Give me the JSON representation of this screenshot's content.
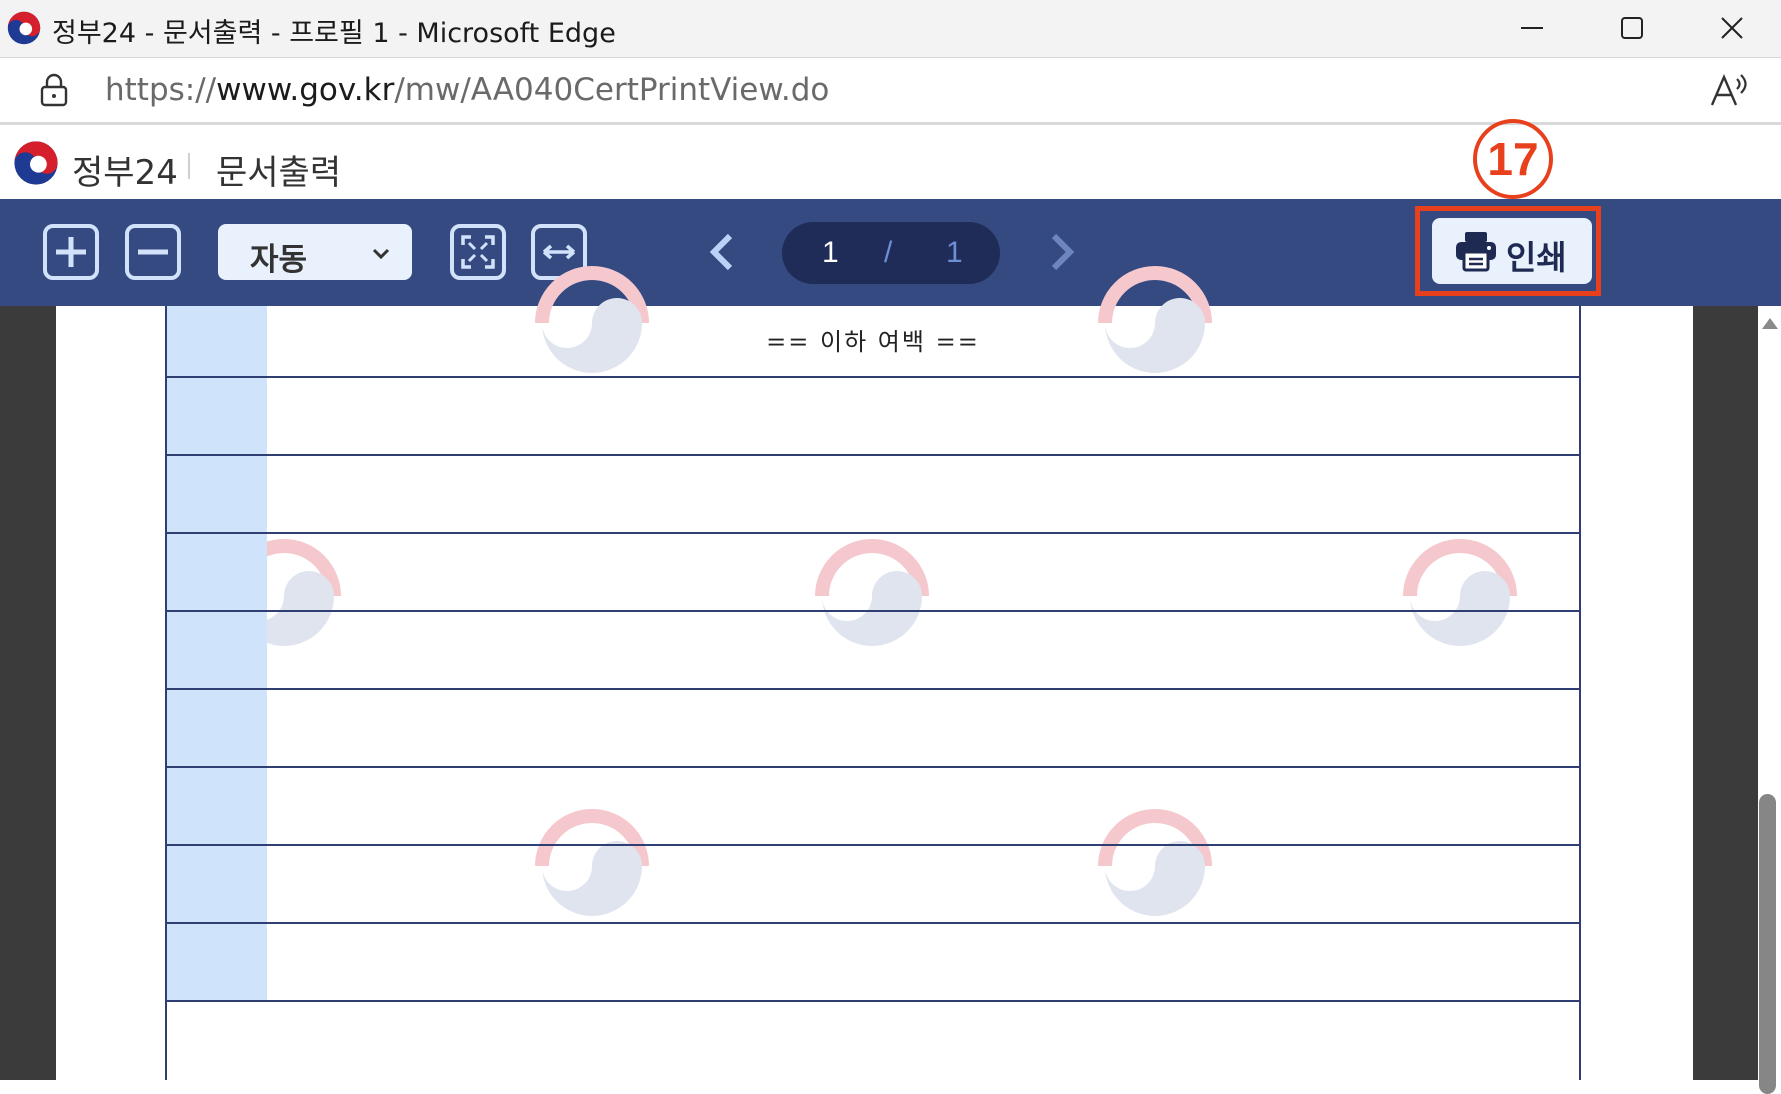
{
  "window": {
    "title": "정부24 - 문서출력 - 프로필 1 - Microsoft Edge",
    "controls": [
      "minimize",
      "maximize",
      "close"
    ]
  },
  "address_bar": {
    "url_prefix": "https://",
    "url_host": "www.gov.kr",
    "url_path": "/mw/AA040CertPrintView.do"
  },
  "site_header": {
    "site_name": "정부24",
    "page_name": "문서출력"
  },
  "step_badge": "17",
  "toolbar": {
    "zoom_value": "자동",
    "current_page": "1",
    "separator": "/",
    "total_pages": "1",
    "print_label": "인쇄",
    "icons": [
      "zoom-in-icon",
      "zoom-out-icon",
      "fit-page-icon",
      "fit-width-icon",
      "chevron-left-icon",
      "chevron-right-icon",
      "printer-icon"
    ]
  },
  "document": {
    "note": "== 이하 여백 =="
  },
  "colors": {
    "toolbar_bg": "#354a80",
    "highlight": "#e8401c",
    "page_pill": "#1e2c57",
    "button_bg": "#e9f1fd"
  }
}
